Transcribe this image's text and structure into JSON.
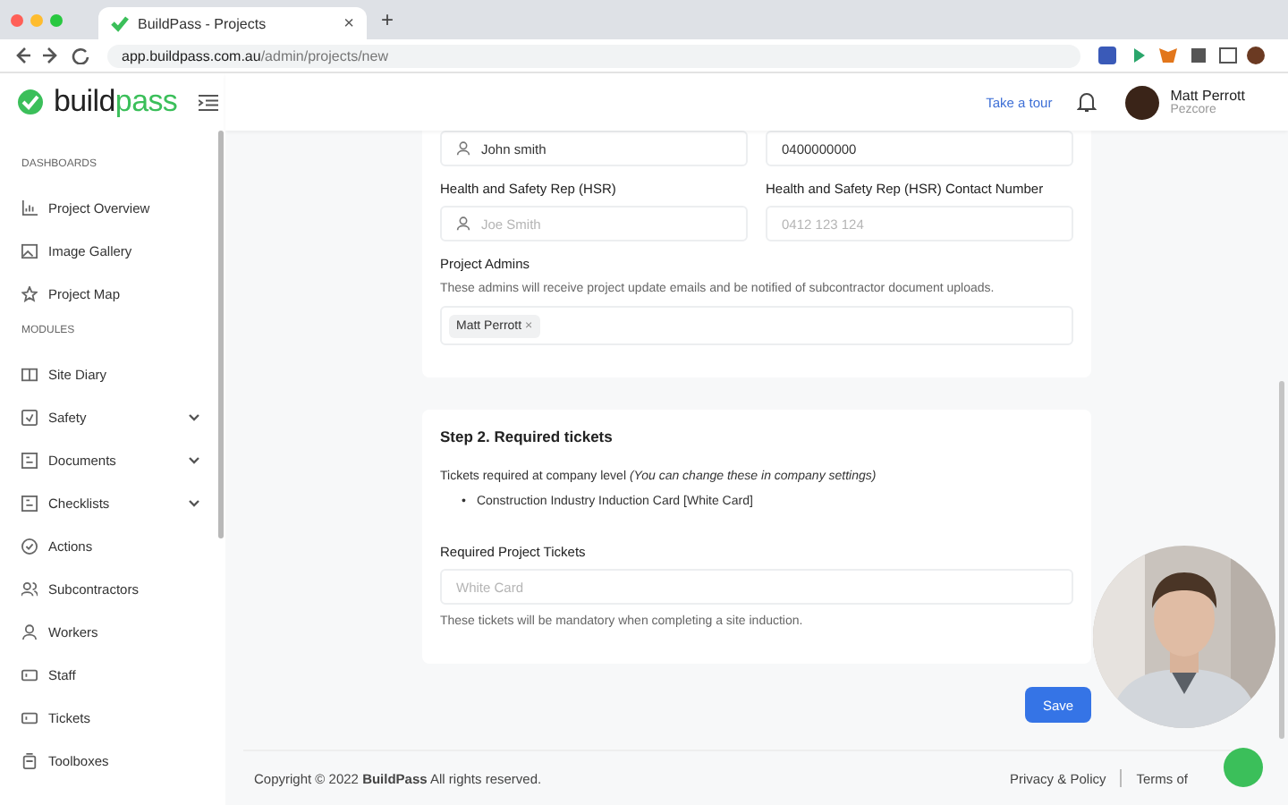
{
  "browser": {
    "tab_title": "BuildPass - Projects",
    "tab_close": "×",
    "new_tab": "+",
    "url_host": "app.buildpass.com.au",
    "url_path": "/admin/projects/new"
  },
  "header": {
    "logo_primary": "build",
    "logo_secondary": "pass",
    "take_tour": "Take a tour",
    "user_name": "Matt Perrott",
    "user_org": "Pezcore"
  },
  "sidebar": {
    "sections": [
      {
        "title": "DASHBOARDS",
        "items": [
          {
            "label": "Project Overview",
            "expandable": false
          },
          {
            "label": "Image Gallery",
            "expandable": false
          },
          {
            "label": "Project Map",
            "expandable": false
          }
        ]
      },
      {
        "title": "MODULES",
        "items": [
          {
            "label": "Site Diary",
            "expandable": false
          },
          {
            "label": "Safety",
            "expandable": true
          },
          {
            "label": "Documents",
            "expandable": true
          },
          {
            "label": "Checklists",
            "expandable": true
          },
          {
            "label": "Actions",
            "expandable": false
          },
          {
            "label": "Subcontractors",
            "expandable": false
          },
          {
            "label": "Workers",
            "expandable": false
          },
          {
            "label": "Staff",
            "expandable": false
          },
          {
            "label": "Tickets",
            "expandable": false
          },
          {
            "label": "Toolboxes",
            "expandable": false
          }
        ]
      }
    ]
  },
  "form": {
    "field_rows": [
      [
        {
          "value": "John smith",
          "kind": "person"
        },
        {
          "value": "0400000000",
          "kind": "plain"
        }
      ],
      [
        {
          "label": "Health and Safety Rep (HSR)",
          "placeholder": "Joe Smith",
          "kind": "person"
        },
        {
          "label": "Health and Safety Rep (HSR) Contact Number",
          "placeholder": "0412 123 124",
          "kind": "plain"
        }
      ]
    ],
    "admins_title": "Project Admins",
    "admins_description": "These admins will receive project update emails and be notified of subcontractor document uploads.",
    "admins": [
      {
        "name": "Matt Perrott",
        "remove": "×"
      }
    ]
  },
  "tickets": {
    "title": "Step 2. Required tickets",
    "company_text": "Tickets required at company level *(You can change these in company settings)*",
    "company_tickets": [
      {
        "bullet": "•",
        "text": "Construction Industry Induction Card [White Card]"
      }
    ],
    "required_label": "Required Project Tickets",
    "required_placeholder": "White Card",
    "help": "These tickets will be mandatory when completing a site induction."
  },
  "save": "Save",
  "footer": {
    "copyright": "Copyright © 2022 **BuildPass** All rights reserved.",
    "links": [
      "Privacy & Policy",
      "Terms of"
    ]
  }
}
